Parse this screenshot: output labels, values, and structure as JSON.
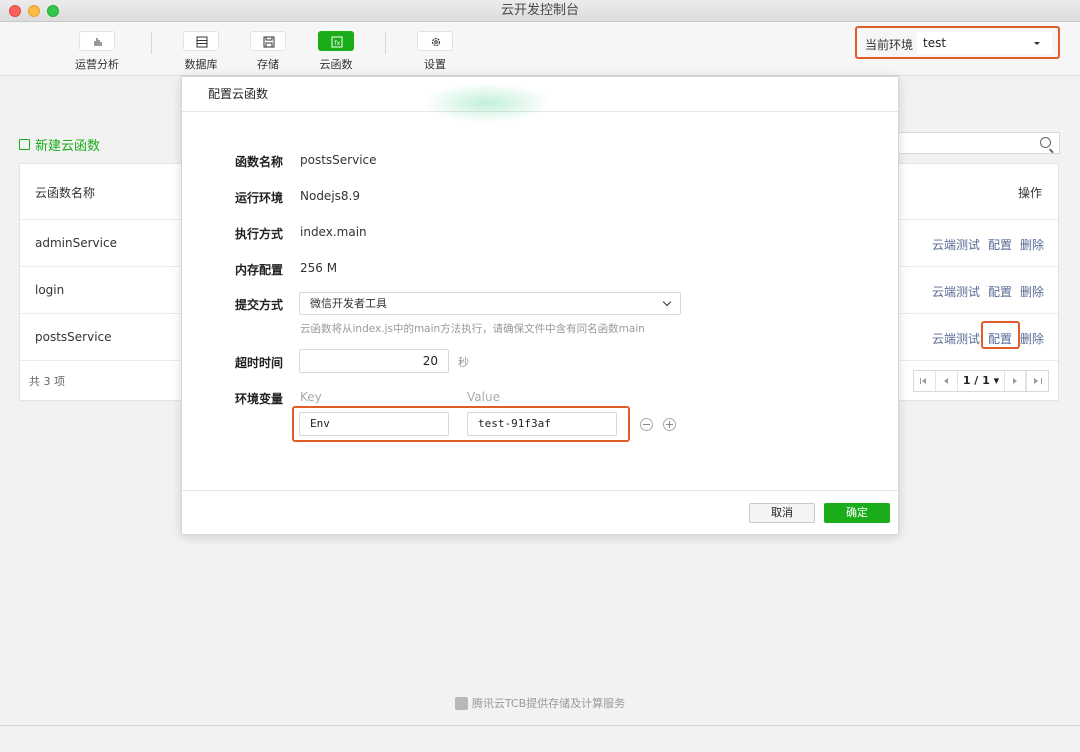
{
  "window": {
    "title": "云开发控制台"
  },
  "toolbar": {
    "items": [
      {
        "label": "运营分析",
        "icon": "bar-chart-icon"
      },
      {
        "label": "数据库",
        "icon": "database-icon"
      },
      {
        "label": "存储",
        "icon": "floppy-disk-icon"
      },
      {
        "label": "云函数",
        "icon": "cloud-function-icon",
        "active": true
      },
      {
        "label": "设置",
        "icon": "gear-icon"
      }
    ],
    "env_label": "当前环境",
    "env_value": "test"
  },
  "page": {
    "new_function": "新建云函数",
    "table": {
      "col_name": "云函数名称",
      "col_ops": "操作",
      "rows": [
        {
          "name": "adminService"
        },
        {
          "name": "login"
        },
        {
          "name": "postsService"
        }
      ],
      "ops": {
        "test": "云端测试",
        "config": "配置",
        "delete": "删除"
      },
      "total": "共 3 项",
      "pager": "1 / 1"
    },
    "footer": "腾讯云TCB提供存储及计算服务"
  },
  "modal": {
    "title": "配置云函数",
    "fields": {
      "name_label": "函数名称",
      "name_value": "postsService",
      "runtime_label": "运行环境",
      "runtime_value": "Nodejs8.9",
      "handler_label": "执行方式",
      "handler_value": "index.main",
      "memory_label": "内存配置",
      "memory_value": "256 M",
      "submit_label": "提交方式",
      "submit_value": "微信开发者工具",
      "hint": "云函数将从index.js中的main方法执行，请确保文件中含有同名函数main",
      "timeout_label": "超时时间",
      "timeout_value": "20",
      "timeout_unit": "秒",
      "env_label": "环境变量",
      "key_header": "Key",
      "value_header": "Value",
      "env_key": "Env",
      "env_value": "test-91f3af"
    },
    "cancel": "取消",
    "confirm": "确定"
  },
  "colors": {
    "accent": "#1aad19",
    "highlight": "#e15c2b",
    "link": "#576b95"
  }
}
